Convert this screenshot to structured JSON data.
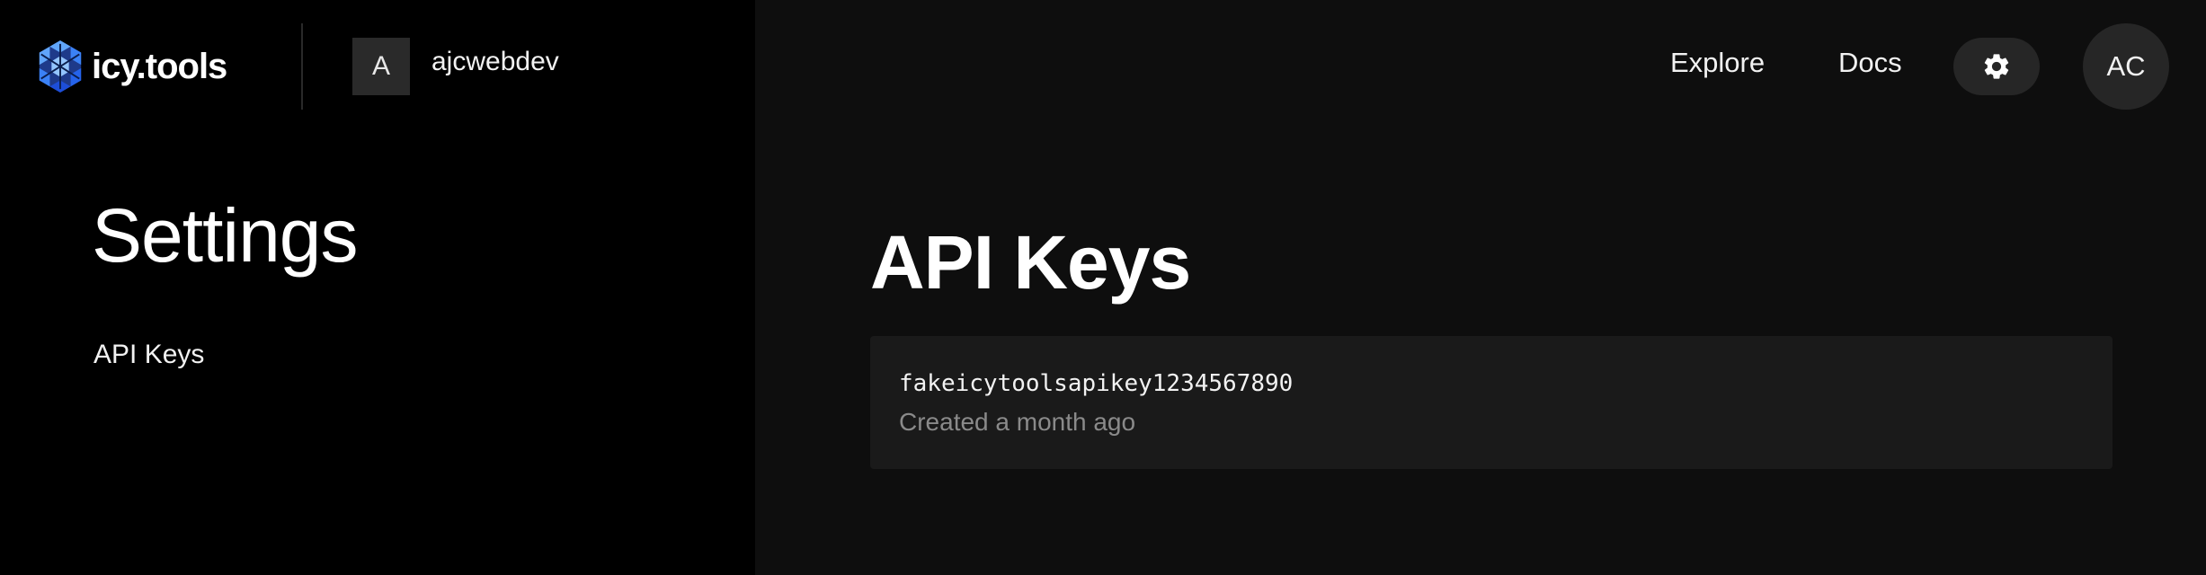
{
  "brand": {
    "name": "icy.tools",
    "icon": "snowflake-logo-icon",
    "accent": "#3b82f6"
  },
  "account": {
    "initial": "A",
    "name": "ajcwebdev"
  },
  "nav": {
    "explore": "Explore",
    "docs": "Docs",
    "settings_icon": "gear-icon"
  },
  "user": {
    "initials": "AC"
  },
  "sidebar": {
    "title": "Settings",
    "items": [
      {
        "label": "API Keys"
      }
    ]
  },
  "main": {
    "title": "API Keys",
    "keys": [
      {
        "value": "fakeicytoolsapikey1234567890",
        "meta": "Created a month ago"
      }
    ]
  }
}
